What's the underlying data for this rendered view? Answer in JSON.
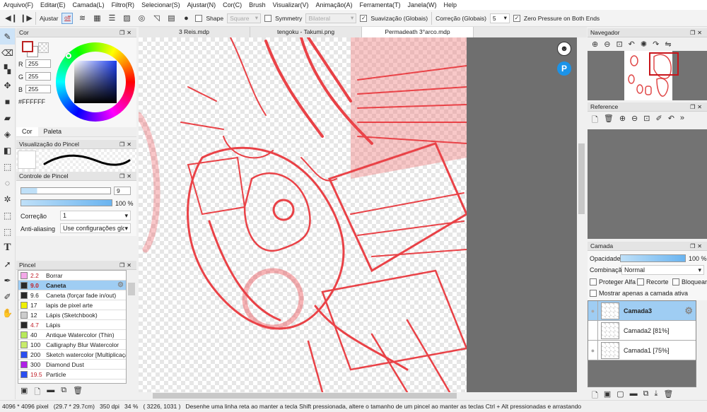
{
  "menu": [
    "Arquivo(F)",
    "Editar(E)",
    "Camada(L)",
    "Filtro(R)",
    "Selecionar(S)",
    "Ajustar(N)",
    "Cor(C)",
    "Brush",
    "Visualizar(V)",
    "Animação(A)",
    "Ferramenta(T)",
    "Janela(W)",
    "Help"
  ],
  "toolbar": {
    "adjust_label": "Ajustar",
    "snap_off": "off",
    "shape_label": "Shape",
    "shape_value": "Square",
    "symmetry_label": "Symmetry",
    "symmetry_value": "Bilateral",
    "smoothing_label": "Suavização (Globais)",
    "smoothing_checked": true,
    "correction_label": "Correção (Globais)",
    "correction_value": "5",
    "zero_pressure_label": "Zero Pressure on Both Ends",
    "zero_pressure_checked": true
  },
  "tabs": [
    "3 Reis.mdp",
    "tengoku - Takumi.png",
    "Permadeath 3°arco.mdp"
  ],
  "active_tab": 2,
  "color_panel": {
    "title": "Cor",
    "r_label": "R",
    "g_label": "G",
    "b_label": "B",
    "r": "255",
    "g": "255",
    "b": "255",
    "hex": "#FFFFFF",
    "tab_color": "Cor",
    "tab_palette": "Paleta"
  },
  "brush_preview": {
    "title": "Visualização do Pincel"
  },
  "brush_control": {
    "title": "Controle de Pincel",
    "size": "9",
    "opacity": "100 %",
    "opacity_value": 100,
    "correction_label": "Correção",
    "correction_value": "1",
    "aa_label": "Anti-aliasing",
    "aa_value": "Use configurações globais"
  },
  "brush_panel": {
    "title": "Pincel",
    "items": [
      {
        "size": "2.2",
        "name": "Borrar",
        "color": "#f4a8e8",
        "red": true
      },
      {
        "size": "9.0",
        "name": "Caneta",
        "color": "#2a2a2a",
        "red": true,
        "selected": true
      },
      {
        "size": "9.6",
        "name": "Caneta (forçar fade in/out)",
        "color": "#2a2a2a"
      },
      {
        "size": "17",
        "name": "lapis de pixel arte",
        "color": "#f0f000"
      },
      {
        "size": "12",
        "name": "Lápis (Sketchbook)",
        "color": "#cccccc"
      },
      {
        "size": "4.7",
        "name": "Lápis",
        "color": "#2a2a2a",
        "red": true
      },
      {
        "size": "40",
        "name": "Antique Watercolor (Thin)",
        "color": "#b8ea5a"
      },
      {
        "size": "100",
        "name": "Calligraphy Blur Watercolor",
        "color": "#c8ec6a"
      },
      {
        "size": "200",
        "name": "Sketch watercolor [Multiplicação]",
        "color": "#2a4ef0"
      },
      {
        "size": "300",
        "name": "Diamond Dust",
        "color": "#b020e8"
      },
      {
        "size": "19.5",
        "name": "Particle",
        "color": "#2a4ef0",
        "red": true
      }
    ]
  },
  "navigator": {
    "title": "Navegador"
  },
  "reference": {
    "title": "Reference"
  },
  "layer_panel": {
    "title": "Camada",
    "opacity_label": "Opacidade",
    "opacity": "100 %",
    "opacity_value": 100,
    "blend_label": "Combinação",
    "blend_value": "Normal",
    "protect_alpha": "Proteger Alfa",
    "clipping": "Recorte",
    "lock": "Bloquear",
    "show_active_only": "Mostrar apenas a camada ativa",
    "layers": [
      {
        "name": "Camada3",
        "active": true,
        "visible": true
      },
      {
        "name": "Camada2 [81%]",
        "visible": false
      },
      {
        "name": "Camada1 [75%]",
        "visible": true
      }
    ]
  },
  "status": {
    "size": "4096 * 4096 pixel",
    "cm": "(29.7 * 29.7cm)",
    "dpi": "350 dpi",
    "zoom": "34 %",
    "coords": "( 3226, 1031 )",
    "hint": "Desenhe uma linha reta ao manter a tecla Shift pressionada, altere o tamanho de um pincel ao manter as teclas Ctrl + Alt pressionadas e arrastando"
  }
}
